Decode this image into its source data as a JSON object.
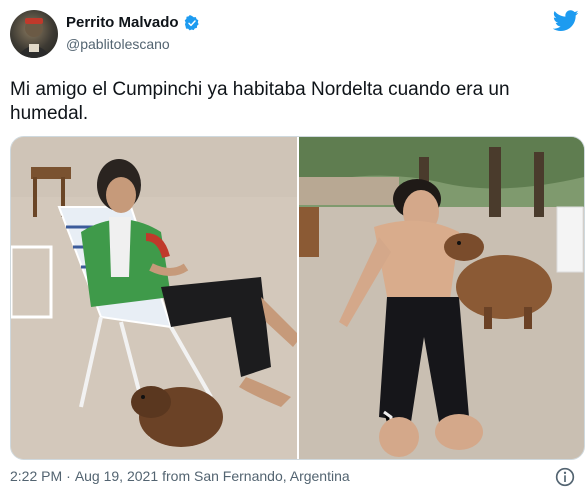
{
  "author": {
    "display_name": "Perrito Malvado",
    "handle": "@pablitolescano",
    "verified": true
  },
  "tweet": {
    "text": "Mi amigo el Cumpinchi ya habitaba Nordelta cuando era un humedal."
  },
  "meta": {
    "time": "2:22 PM",
    "separator": "·",
    "date": "Aug 19, 2021",
    "source": "from San Fernando, Argentina"
  },
  "icons": {
    "brand": "twitter-bird-icon",
    "verified": "verified-badge-icon",
    "info": "info-icon"
  },
  "colors": {
    "brand_blue": "#1d9bf0",
    "text_primary": "#0f1419",
    "text_secondary": "#536471"
  }
}
